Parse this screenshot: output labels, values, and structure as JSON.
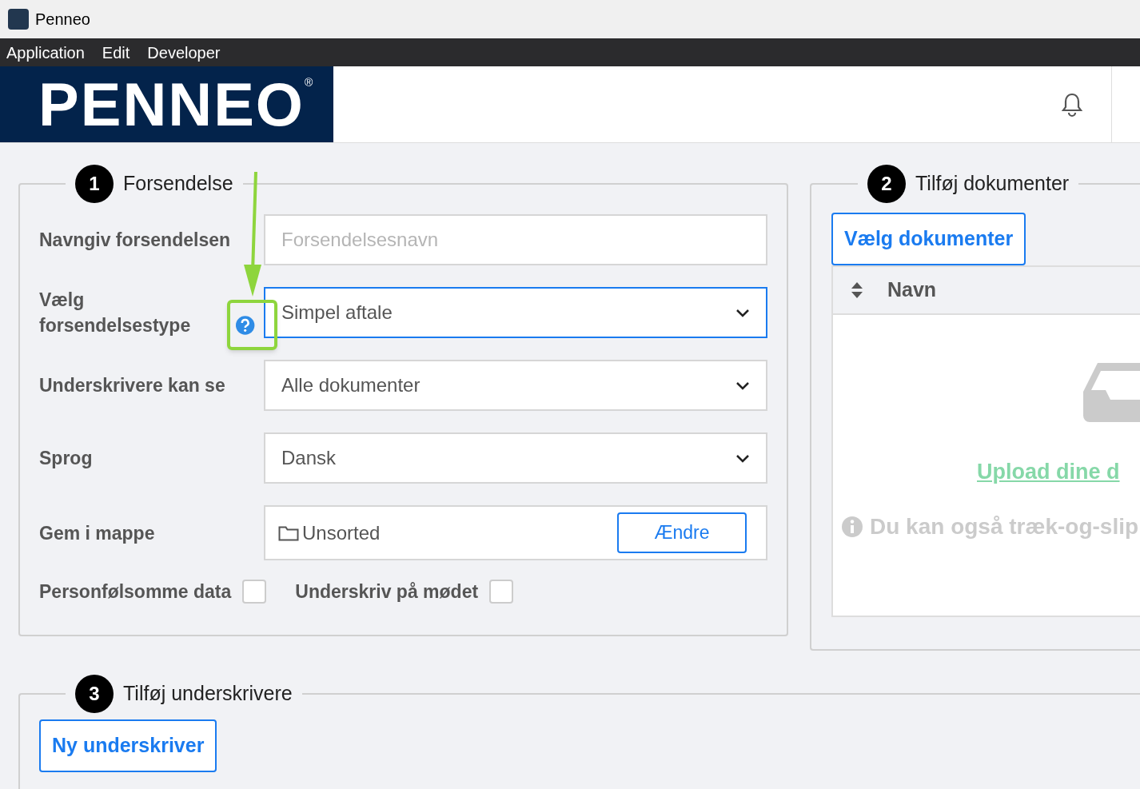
{
  "window": {
    "title": "Penneo"
  },
  "menu": [
    "Application",
    "Edit",
    "Developer"
  ],
  "header": {
    "logo": "PENNEO",
    "registered": "®"
  },
  "section1": {
    "number": "1",
    "title": "Forsendelse",
    "fields": [
      {
        "kind": "text",
        "label": "Navngiv forsendelsen",
        "placeholder": "Forsendelsesnavn",
        "focused": false,
        "help": false,
        "highlighted": false
      },
      {
        "kind": "select",
        "label": "Vælg forsendelsestype",
        "value": "Simpel aftale",
        "focused": true,
        "help": true,
        "highlighted": true
      },
      {
        "kind": "select",
        "label": "Underskrivere kan se",
        "value": "Alle dokumenter",
        "focused": false,
        "help": false,
        "highlighted": false
      },
      {
        "kind": "select",
        "label": "Sprog",
        "value": "Dansk",
        "focused": false,
        "help": false,
        "highlighted": false
      },
      {
        "kind": "folder",
        "label": "Gem i mappe",
        "value": "Unsorted",
        "button": "Ændre",
        "focused": false,
        "help": false,
        "highlighted": false
      }
    ],
    "checkboxes": [
      {
        "label": "Personfølsomme data",
        "checked": false
      },
      {
        "label": "Underskriv på mødet",
        "checked": false
      }
    ]
  },
  "section2": {
    "number": "2",
    "title": "Tilføj dokumenter",
    "button": "Vælg dokumenter",
    "table": {
      "columns": [
        "Navn"
      ]
    },
    "empty": {
      "link": "Upload dine d",
      "hint": "Du kan også træk-og-slip"
    }
  },
  "section3": {
    "number": "3",
    "title": "Tilføj underskrivere",
    "button": "Ny underskriver"
  }
}
